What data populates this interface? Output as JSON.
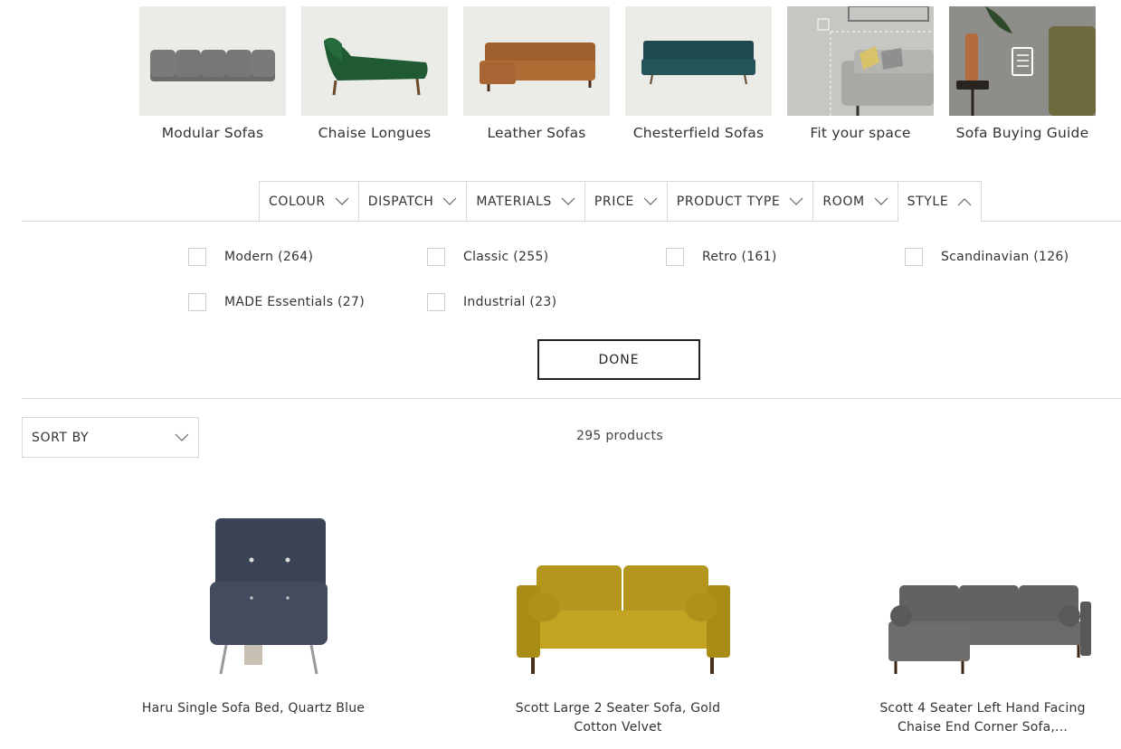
{
  "categories": [
    {
      "label": "Modular Sofas",
      "icon": "modular-sofa-image"
    },
    {
      "label": "Chaise Longues",
      "icon": "chaise-longue-image"
    },
    {
      "label": "Leather Sofas",
      "icon": "leather-sofa-image"
    },
    {
      "label": "Chesterfield Sofas",
      "icon": "chesterfield-sofa-image"
    },
    {
      "label": "Fit your space",
      "icon": "fit-space-image"
    },
    {
      "label": "Sofa Buying Guide",
      "icon": "buying-guide-image"
    }
  ],
  "filters": {
    "tabs": [
      "COLOUR",
      "DISPATCH",
      "MATERIALS",
      "PRICE",
      "PRODUCT TYPE",
      "ROOM",
      "STYLE"
    ],
    "active": "STYLE",
    "style_options": [
      "Modern (264)",
      "Classic (255)",
      "Retro (161)",
      "Scandinavian (126)",
      "MADE Essentials (27)",
      "Industrial (23)"
    ],
    "done_label": "DONE"
  },
  "sort": {
    "label": "SORT BY"
  },
  "results": {
    "count_text": "295 products"
  },
  "products": [
    {
      "name_line1": "Haru Single Sofa Bed, Quartz Blue",
      "name_line2": "",
      "color": "#3b4456"
    },
    {
      "name_line1": "Scott Large 2 Seater Sofa, Gold",
      "name_line2": "Cotton Velvet",
      "color": "#b89a1c"
    },
    {
      "name_line1": "Scott 4 Seater Left Hand Facing",
      "name_line2": "Chaise End Corner Sofa,...",
      "color": "#5f5f5d"
    }
  ]
}
